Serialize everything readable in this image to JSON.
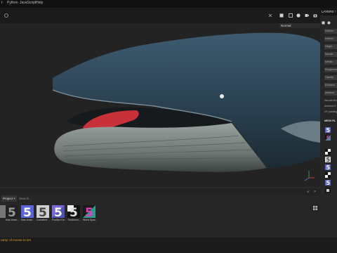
{
  "menubar": {
    "items": [
      "t",
      "Python",
      "JavaScript",
      "Help"
    ]
  },
  "viewport": {
    "shading_mode": "Normal"
  },
  "right_panel": {
    "tab_layers": "LAYERS",
    "tab_t": "T",
    "fields": [
      "Uniform",
      "Uniform",
      "Height",
      "Normal",
      "Metalic",
      "Roughness",
      "Opacity",
      "Emissive",
      "Ambient"
    ],
    "text_normal": "Normal Mix",
    "text_ambient": "Ambient O",
    "text_uv": "UV padding",
    "section_mesh": "MESH FIL"
  },
  "shelf": {
    "tab_label": "Project",
    "search_placeholder": "Search...",
    "assets": [
      {
        "label": ""
      },
      {
        "label": "blue-cham..."
      },
      {
        "label": "blue-cham..."
      },
      {
        "label": "Curvature..."
      },
      {
        "label": "Position De..."
      },
      {
        "label": "Thickness..."
      },
      {
        "label": "World Spac..."
      }
    ]
  },
  "status": {
    "message": "ranty' of mouse to set"
  },
  "colors": {
    "accent": "#5b63d8",
    "status_text": "#e0a030"
  },
  "icons": [
    "menu-icon",
    "grid-icon",
    "camera-icon",
    "render-icon",
    "settings-icon",
    "close-icon",
    "axis-gizmo-icon"
  ]
}
